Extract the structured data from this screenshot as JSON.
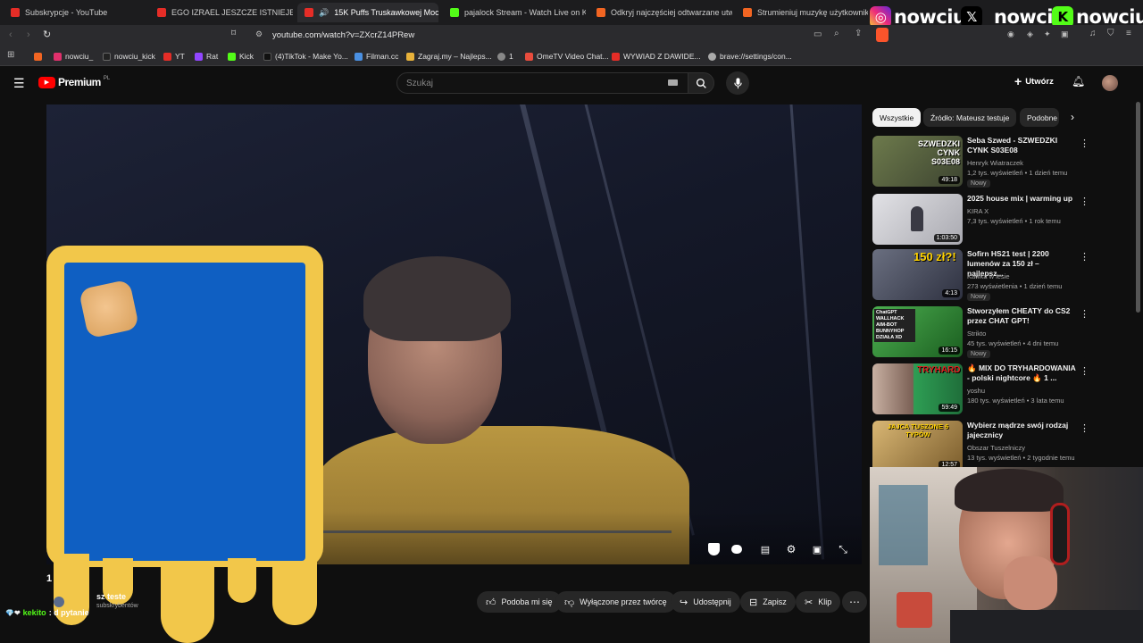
{
  "browser": {
    "tabs": [
      {
        "label": "Subskrypcje - YouTube",
        "favicon_color": "#e52d27"
      },
      {
        "label": "EGO IZRAEL JESZCZE ISTNIEJE",
        "favicon_color": "#e52d27"
      },
      {
        "label": "15K Puffs Truskawkowej Moc",
        "favicon_color": "#e52d27",
        "active": true
      },
      {
        "label": "pajalock Stream - Watch Live on Kick",
        "favicon_color": "#53fc18"
      },
      {
        "label": "Odkryj najczęściej odtwarzane utwor",
        "favicon_color": "#f26522"
      },
      {
        "label": "Strumieniuj muzykę użytkownika SP",
        "favicon_color": "#f26522"
      }
    ],
    "url": "youtube.com/watch?v=ZXcrZ14PRew",
    "bookmarks": [
      {
        "label": "",
        "color": "#f26522"
      },
      {
        "label": "nowciu_",
        "color": "#e1306c"
      },
      {
        "label": "nowciu_kick",
        "color": "#222"
      },
      {
        "label": "YT",
        "color": "#e52d27"
      },
      {
        "label": "Rat",
        "color": "#9146ff"
      },
      {
        "label": "Kick",
        "color": "#53fc18"
      },
      {
        "label": "(4)TikTok - Make Yo...",
        "color": "#111"
      },
      {
        "label": "Filman.cc",
        "color": "#4a90e2"
      },
      {
        "label": "Zagraj.my – Najleps...",
        "color": "#e8b23a"
      },
      {
        "label": "1",
        "color": "#888"
      },
      {
        "label": "OmeTV Video Chat...",
        "color": "#e84c3d"
      },
      {
        "label": "WYWIAD Z DAWIDE...",
        "color": "#e52d27"
      },
      {
        "label": "brave://settings/con...",
        "color": "#aaa"
      }
    ]
  },
  "social": {
    "instagram": "nowciu_",
    "x": "_nowciu",
    "kick": "nowciu"
  },
  "youtube": {
    "logo": "Premium",
    "logo_region": "PL",
    "search_placeholder": "Szukaj",
    "create_label": "Utwórz",
    "actions": {
      "like": "Podoba mi się",
      "dislike": "Wyłączone przez twórcę",
      "share": "Udostępnij",
      "save": "Zapisz",
      "clip": "Klip"
    },
    "channel_fragment": "sz teste",
    "subs_fragment": "subskrybentów",
    "title_fragment": "1",
    "chat": {
      "user": "kekito",
      "message": ": d     pytanie"
    }
  },
  "sidebar": {
    "chips": [
      "Wszystkie",
      "Źródło: Mateusz testuje",
      "Podobne"
    ],
    "videos": [
      {
        "title": "Seba Szwed - SZWEDZKI CYNK S03E08",
        "channel": "Henryk Wiatraczek",
        "meta": "1,2 tys. wyświetleń • 1 dzień temu",
        "badge": "Nowy",
        "duration": "49:18",
        "thumb": "#4e5a3a"
      },
      {
        "title": "2025 house mix | warming up",
        "channel": "KIRA X",
        "meta": "7,3 tys. wyświetleń • 1 rok temu",
        "badge": "",
        "duration": "1:03:50",
        "thumb": "#c9c9cc"
      },
      {
        "title": "Sofirn HS21 test | 2200 lumenów za 150 zł – najlepsz...",
        "channel": "Kawka w lesie",
        "meta": "273 wyświetlenia • 1 dzień temu",
        "badge": "Nowy",
        "duration": "4:13",
        "thumb": "#4b5163"
      },
      {
        "title": "Stworzyłem CHEATY do CS2 przez CHAT GPT!",
        "channel": "Strikto",
        "meta": "45 tys. wyświetleń • 4 dni temu",
        "badge": "Nowy",
        "duration": "16:15",
        "thumb": "#3c7a3a"
      },
      {
        "title": "🔥 MIX DO TRYHARDOWANIA - polski nightcore 🔥 1 ...",
        "channel": "yoshu",
        "meta": "180 tys. wyświetleń • 3 lata temu",
        "badge": "",
        "duration": "59:49",
        "thumb": "#2e8f4a"
      },
      {
        "title": "Wybierz mądrze swój rodzaj jajecznicy",
        "channel": "Obszar Tuszelniczy",
        "meta": "13 tys. wyświetleń • 2 tygodnie temu",
        "badge": "",
        "duration": "12:57",
        "thumb": "#b89a5c"
      }
    ],
    "thumb_overlays": [
      "SZWEDZKI CYNK S03E08",
      "",
      "150 zł?!",
      "ChatGPT WALLHACK AIM-BOT BUNNYHOP DZIAŁA XD",
      "TRYHARD",
      "JAJCA TUSZONE 6 TYPÓW"
    ]
  }
}
